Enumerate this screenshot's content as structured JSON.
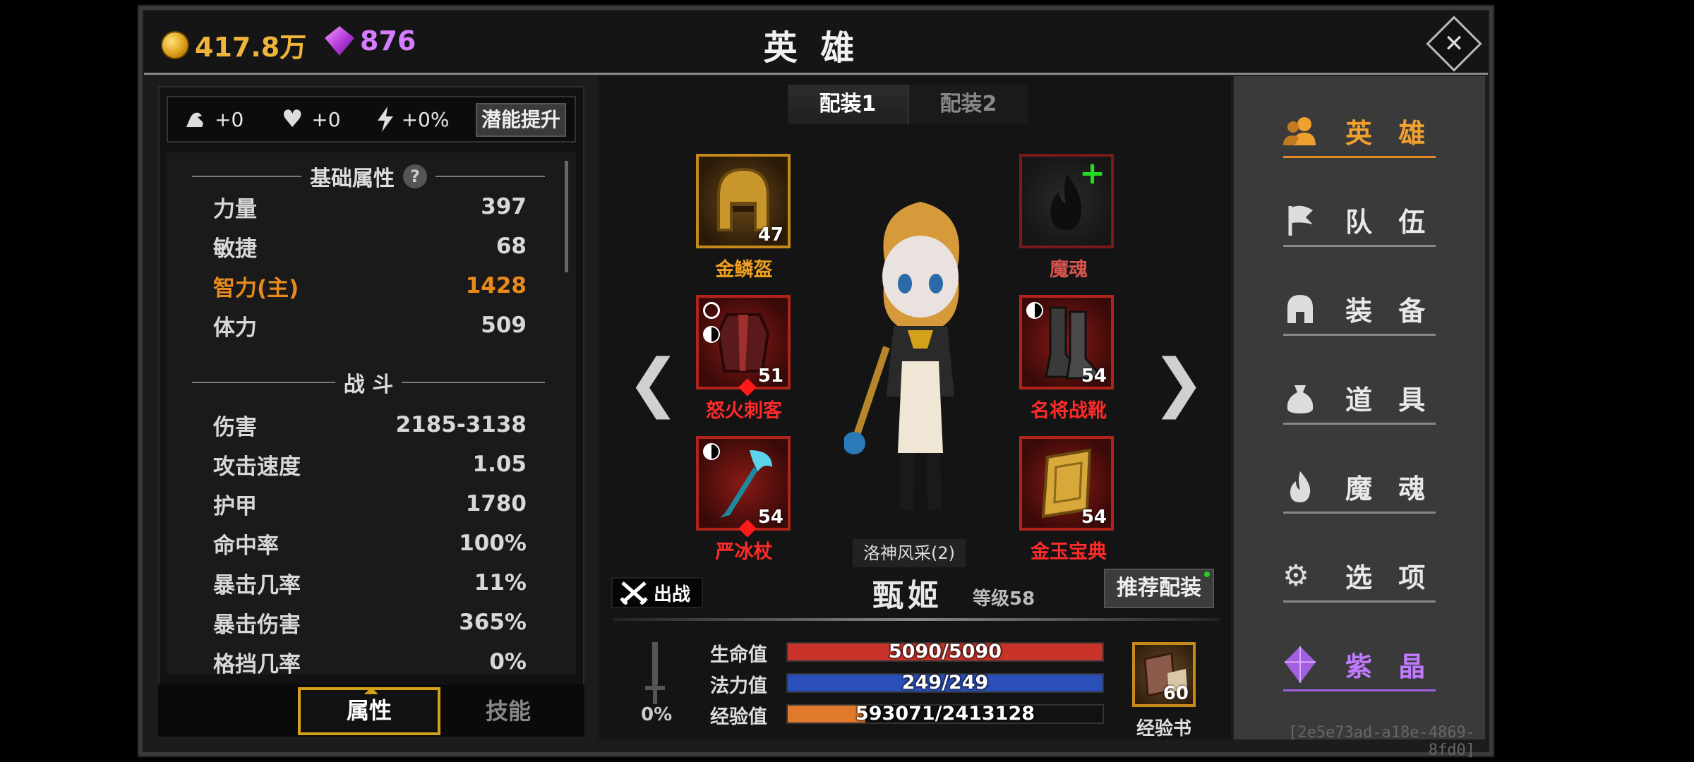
{
  "top": {
    "gold": "417.8万",
    "gems": "876",
    "title": "英 雄"
  },
  "left": {
    "bonus": {
      "strength": "+0",
      "health": "+0",
      "speed": "+0%"
    },
    "potential_label": "潜能提升",
    "basic_header": "基础属性",
    "basic": [
      {
        "name": "力量",
        "value": "397"
      },
      {
        "name": "敏捷",
        "value": "68"
      },
      {
        "name": "智力(主)",
        "value": "1428"
      },
      {
        "name": "体力",
        "value": "509"
      }
    ],
    "combat_header": "战 斗",
    "combat": [
      {
        "name": "伤害",
        "value": "2185-3138"
      },
      {
        "name": "攻击速度",
        "value": "1.05"
      },
      {
        "name": "护甲",
        "value": "1780"
      },
      {
        "name": "命中率",
        "value": "100%"
      },
      {
        "name": "暴击几率",
        "value": "11%"
      },
      {
        "name": "暴击伤害",
        "value": "365%"
      },
      {
        "name": "格挡几率",
        "value": "0%"
      }
    ],
    "tabs": {
      "attributes": "属性",
      "skills": "技能"
    }
  },
  "center": {
    "loadouts": [
      "配装1",
      "配装2"
    ],
    "slots": {
      "helmet": {
        "name": "金鳞盔",
        "level": "47"
      },
      "soul": {
        "name": "魔魂"
      },
      "armor": {
        "name": "怒火刺客",
        "level": "51"
      },
      "boots": {
        "name": "名将战靴",
        "level": "54"
      },
      "weapon": {
        "name": "严冰杖",
        "level": "54"
      },
      "book": {
        "name": "金玉宝典",
        "level": "54"
      }
    },
    "arrows": {
      "left": "❮",
      "right": "❯"
    },
    "skin": "洛神风采(2)",
    "deploy": "出战",
    "hero_name": "甄姬",
    "hero_level": "等级58",
    "recommend": "推荐配装",
    "stats": {
      "hp_label": "生命值",
      "hp_text": "5090/5090",
      "hp_ratio": 1.0,
      "mp_label": "法力值",
      "mp_text": "249/249",
      "mp_ratio": 1.0,
      "xp_label": "经验值",
      "xp_text": "593071/2413128",
      "xp_ratio": 0.246
    },
    "weapon_pct": "0%",
    "exp_book": {
      "count": "60",
      "label": "经验书"
    }
  },
  "nav": {
    "items": [
      {
        "label": "英 雄",
        "icon": "hero-icon"
      },
      {
        "label": "队 伍",
        "icon": "flag-icon"
      },
      {
        "label": "装 备",
        "icon": "helmet-icon"
      },
      {
        "label": "道 具",
        "icon": "bag-icon"
      },
      {
        "label": "魔 魂",
        "icon": "flame-icon"
      },
      {
        "label": "选 项",
        "icon": "gear-icon"
      },
      {
        "label": "紫 晶",
        "icon": "crystal-icon"
      }
    ]
  },
  "uuid": "[2e5e73ad-a18e-4869-8fd0]",
  "colors": {
    "accent": "#f0a030",
    "hp": "#c8342a",
    "mp": "#2a4fb8",
    "xp": "#e07a2a",
    "purple": "#c07aff"
  }
}
